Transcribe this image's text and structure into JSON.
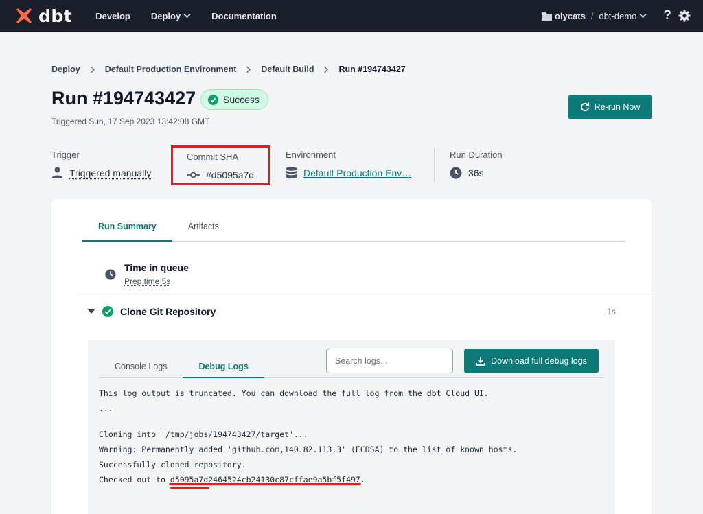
{
  "nav": {
    "logo_text": "dbt",
    "links": [
      "Develop",
      "Deploy",
      "Documentation"
    ],
    "account": "olycats",
    "separator": "/",
    "project": "dbt-demo",
    "help": "?"
  },
  "breadcrumb": [
    "Deploy",
    "Default Production Environment",
    "Default Build",
    "Run #194743427"
  ],
  "header": {
    "title": "Run #194743427",
    "status": "Success",
    "triggered": "Triggered Sun, 17 Sep 2023 13:42:08 GMT",
    "rerun_label": "Re-run Now"
  },
  "meta": {
    "trigger_label": "Trigger",
    "trigger_value": "Triggered manually",
    "commit_label": "Commit SHA",
    "commit_value": "#d5095a7d",
    "env_label": "Environment",
    "env_value": "Default Production Env…",
    "duration_label": "Run Duration",
    "duration_value": "36s"
  },
  "tabs": [
    "Run Summary",
    "Artifacts"
  ],
  "queue": {
    "title": "Time in queue",
    "sub": "Prep time 5s"
  },
  "step": {
    "name": "Clone Git Repository",
    "duration": "1s"
  },
  "logs": {
    "tabs": [
      "Console Logs",
      "Debug Logs"
    ],
    "search_placeholder": "Search logs...",
    "download_label": "Download full debug logs",
    "line1": "This log output is truncated. You can download the full log from the dbt Cloud UI.",
    "line2": "...",
    "line3": "Cloning into '/tmp/jobs/194743427/target'...",
    "line4": "Warning: Permanently added 'github.com,140.82.113.3' (ECDSA) to the list of known hosts.",
    "line5": "Successfully cloned repository.",
    "line6_prefix": "Checked out to ",
    "line6_sha": "d5095a7d2464524cb24130c87cffae9a5bf5f497",
    "line6_suffix": "."
  },
  "colors": {
    "accent": "#0e7a78",
    "nav_bg": "#1b1e2b",
    "success_bg": "#d1fae5",
    "highlight": "#e11d24",
    "logo": "#ff694a"
  }
}
